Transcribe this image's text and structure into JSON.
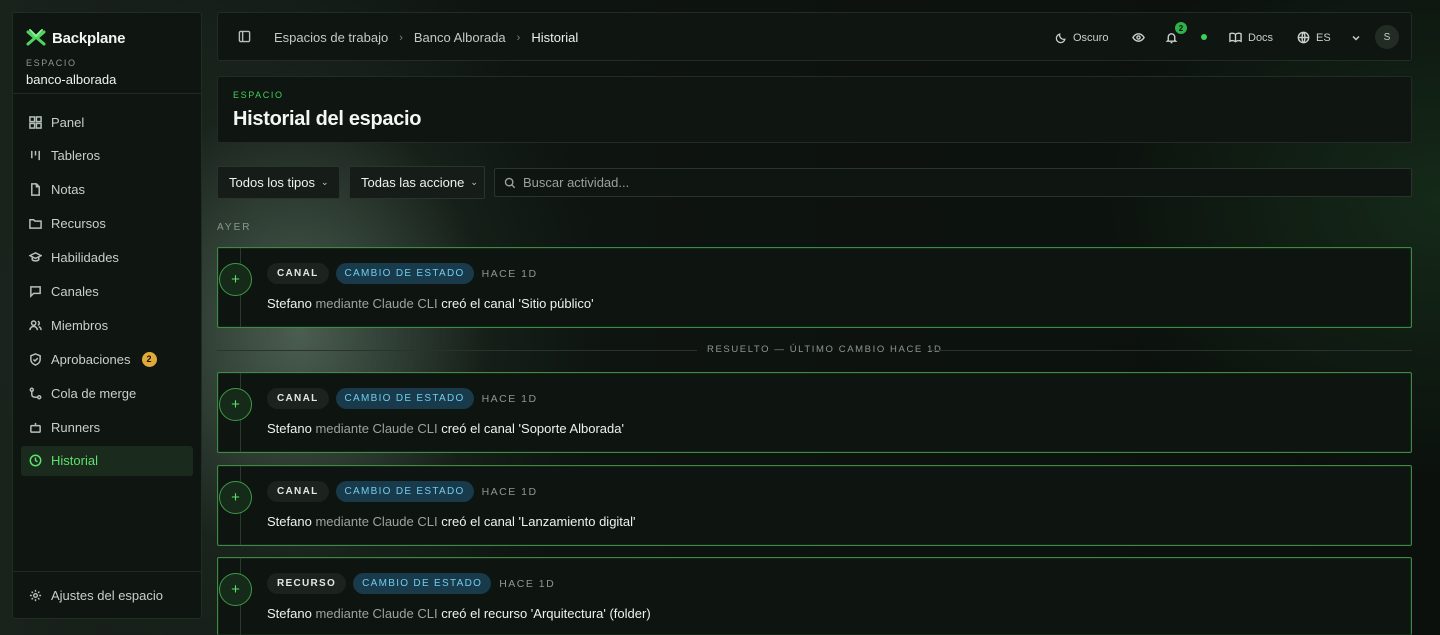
{
  "app": {
    "brand": "Backplane",
    "space_label": "ESPACIO",
    "space_name": "banco-alborada"
  },
  "sidebar": {
    "items": [
      {
        "label": "Panel",
        "icon": "grid-icon"
      },
      {
        "label": "Tableros",
        "icon": "kanban-icon"
      },
      {
        "label": "Notas",
        "icon": "file-icon"
      },
      {
        "label": "Recursos",
        "icon": "folder-icon"
      },
      {
        "label": "Habilidades",
        "icon": "graduation-cap-icon"
      },
      {
        "label": "Canales",
        "icon": "message-square-icon"
      },
      {
        "label": "Miembros",
        "icon": "users-icon"
      },
      {
        "label": "Aprobaciones",
        "icon": "shield-check-icon",
        "badge": "2"
      },
      {
        "label": "Cola de merge",
        "icon": "git-merge-icon"
      },
      {
        "label": "Runners",
        "icon": "bot-icon"
      },
      {
        "label": "Historial",
        "icon": "clock-icon",
        "active": true
      }
    ],
    "settings_label": "Ajustes del espacio"
  },
  "topbar": {
    "breadcrumbs": [
      "Espacios de trabajo",
      "Banco Alborada",
      "Historial"
    ],
    "theme_label": "Oscuro",
    "notifications_count": "2",
    "docs_label": "Docs",
    "language": "ES",
    "avatar_initial": "S"
  },
  "header": {
    "eyebrow": "ESPACIO",
    "title": "Historial del espacio"
  },
  "filters": {
    "type_label": "Todos los tipos",
    "action_label": "Todas las accione",
    "search_placeholder": "Buscar actividad..."
  },
  "section_label": "AYER",
  "divider_text": "RESUELTO — ÚLTIMO CAMBIO HACE 1D",
  "activity": [
    {
      "type": "CANAL",
      "action": "CAMBIO DE ESTADO",
      "time": "HACE 1D",
      "actor": "Stefano",
      "via": "mediante Claude CLI",
      "text": "creó el canal 'Sitio público'"
    },
    {
      "type": "CANAL",
      "action": "CAMBIO DE ESTADO",
      "time": "HACE 1D",
      "actor": "Stefano",
      "via": "mediante Claude CLI",
      "text": "creó el canal 'Soporte Alborada'"
    },
    {
      "type": "CANAL",
      "action": "CAMBIO DE ESTADO",
      "time": "HACE 1D",
      "actor": "Stefano",
      "via": "mediante Claude CLI",
      "text": "creó el canal 'Lanzamiento digital'"
    },
    {
      "type": "RECURSO",
      "action": "CAMBIO DE ESTADO",
      "time": "HACE 1D",
      "actor": "Stefano",
      "via": "mediante Claude CLI",
      "text": "creó el recurso 'Arquitectura' (folder)"
    }
  ],
  "colors": {
    "accent": "#5ee06a",
    "badge": "#e0a93a",
    "action_tag": "#6fcdf0"
  }
}
